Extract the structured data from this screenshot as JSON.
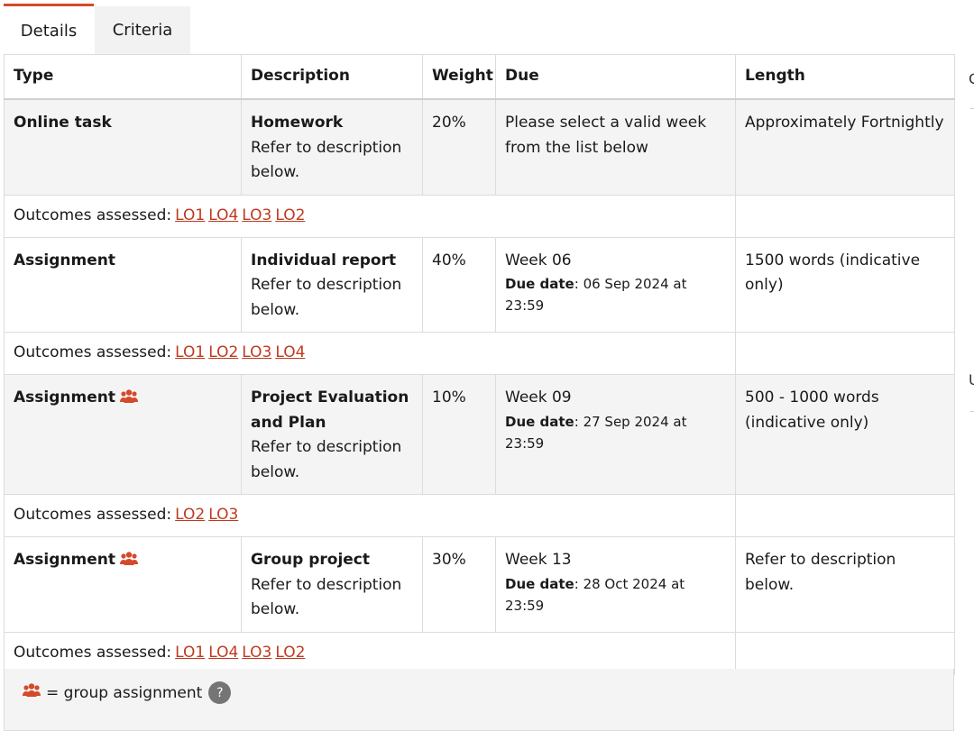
{
  "tabs": [
    {
      "label": "Details"
    },
    {
      "label": "Criteria"
    }
  ],
  "headers": {
    "type": "Type",
    "description": "Description",
    "weight": "Weight",
    "due": "Due",
    "length": "Length"
  },
  "outcomes_label": "Outcomes assessed:",
  "due_date_label": "Due date",
  "rows": [
    {
      "type": "Online task",
      "group": false,
      "desc_title": "Homework",
      "desc_body": "Refer to description below.",
      "weight": "20%",
      "due_week": "Please select a valid week from the list below",
      "due_date": "",
      "length": "Approximately Fortnightly",
      "outcomes": [
        "LO1",
        "LO4",
        "LO3",
        "LO2"
      ]
    },
    {
      "type": "Assignment",
      "group": false,
      "desc_title": "Individual report",
      "desc_body": "Refer to description below.",
      "weight": "40%",
      "due_week": "Week 06",
      "due_date": "06 Sep 2024 at 23:59",
      "length": "1500 words (indicative only)",
      "outcomes": [
        "LO1",
        "LO2",
        "LO3",
        "LO4"
      ]
    },
    {
      "type": "Assignment",
      "group": true,
      "desc_title": "Project Evaluation and Plan",
      "desc_body": "Refer to description below.",
      "weight": "10%",
      "due_week": "Week 09",
      "due_date": "27 Sep 2024 at 23:59",
      "length": "500 - 1000 words (indicative only)",
      "outcomes": [
        "LO2",
        "LO3"
      ]
    },
    {
      "type": "Assignment",
      "group": true,
      "desc_title": "Group project",
      "desc_body": "Refer to description below.",
      "weight": "30%",
      "due_week": "Week 13",
      "due_date": "28 Oct 2024 at 23:59",
      "length": "Refer to description below.",
      "outcomes": [
        "LO1",
        "LO4",
        "LO3",
        "LO2"
      ]
    }
  ],
  "legend": {
    "text": "= group assignment",
    "help": "?"
  },
  "side_fragments": [
    "C",
    "U"
  ],
  "colors": {
    "accent": "#d44a2a",
    "link": "#c0391f",
    "shade": "#f4f4f4"
  }
}
